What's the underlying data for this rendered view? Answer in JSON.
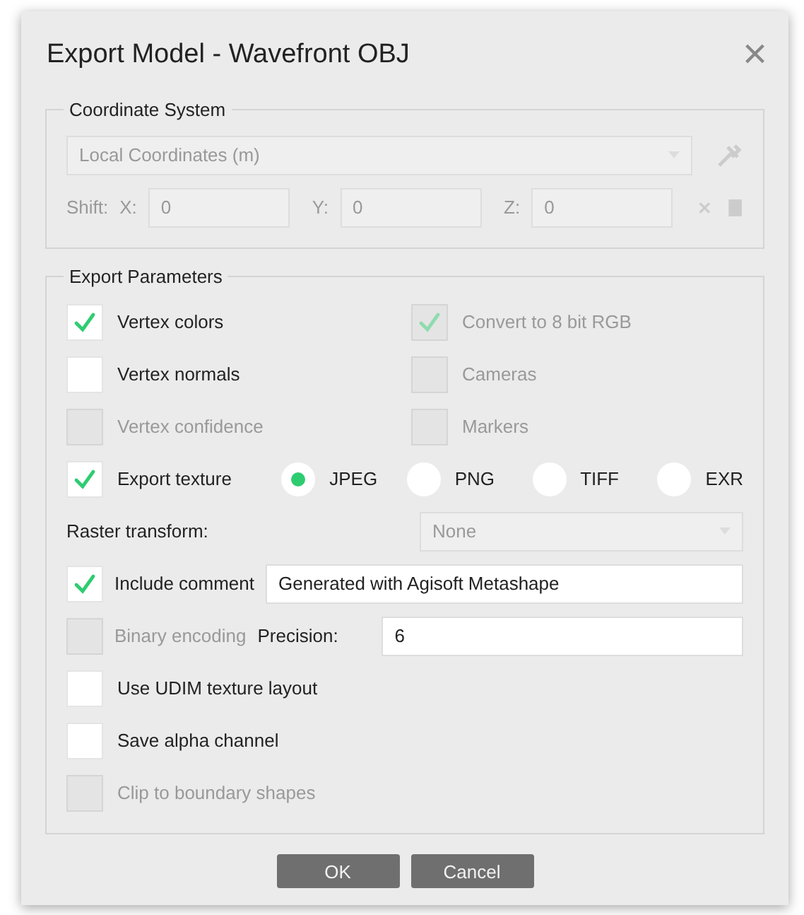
{
  "window": {
    "title": "Export Model - Wavefront OBJ",
    "close": "×"
  },
  "coordinate_system": {
    "title": "Coordinate System",
    "disabled": true,
    "dropdown": {
      "value": "Local Coordinates (m)"
    },
    "shift_label": "Shift:",
    "fields": [
      {
        "label": "X:",
        "value": "0"
      },
      {
        "label": "Y:",
        "value": "0"
      },
      {
        "label": "Z:",
        "value": "0"
      }
    ]
  },
  "export_parameters": {
    "title": "Export Parameters",
    "rows": [
      {
        "kind": "pair",
        "items": [
          {
            "label": "Vertex colors",
            "checked": true,
            "disabled": false
          },
          {
            "label": "Convert to 8 bit RGB",
            "checked": true,
            "disabled": true
          }
        ]
      },
      {
        "kind": "pair",
        "items": [
          {
            "label": "Vertex normals",
            "checked": false,
            "disabled": false
          },
          {
            "label": "Cameras",
            "checked": false,
            "disabled": true
          }
        ]
      },
      {
        "kind": "pair",
        "items": [
          {
            "label": "Vertex confidence",
            "checked": false,
            "disabled": true
          },
          {
            "label": "Markers",
            "checked": false,
            "disabled": true
          }
        ]
      },
      {
        "kind": "texture",
        "item": {
          "label": "Export texture",
          "checked": true,
          "disabled": false
        },
        "formats": [
          {
            "label": "JPEG",
            "selected": true
          },
          {
            "label": "PNG",
            "selected": false
          },
          {
            "label": "TIFF",
            "selected": false
          },
          {
            "label": "EXR",
            "selected": false
          }
        ]
      },
      {
        "kind": "select",
        "label": "Raster transform:",
        "value": "None",
        "disabled": true
      },
      {
        "kind": "comment",
        "item": {
          "label": "Include comment",
          "checked": true,
          "disabled": false
        },
        "value": "Generated with Agisoft Metashape"
      },
      {
        "kind": "precision",
        "item": {
          "label": "Binary encoding",
          "checked": false,
          "disabled": true
        },
        "label": "Precision:",
        "value": "6"
      },
      {
        "kind": "single",
        "item": {
          "label": "Use UDIM texture layout",
          "checked": false,
          "disabled": false
        }
      },
      {
        "kind": "single",
        "item": {
          "label": "Save alpha channel",
          "checked": false,
          "disabled": false
        }
      },
      {
        "kind": "single",
        "item": {
          "label": "Clip to boundary shapes",
          "checked": false,
          "disabled": true
        }
      }
    ]
  },
  "buttons": [
    "OK",
    "Cancel"
  ]
}
